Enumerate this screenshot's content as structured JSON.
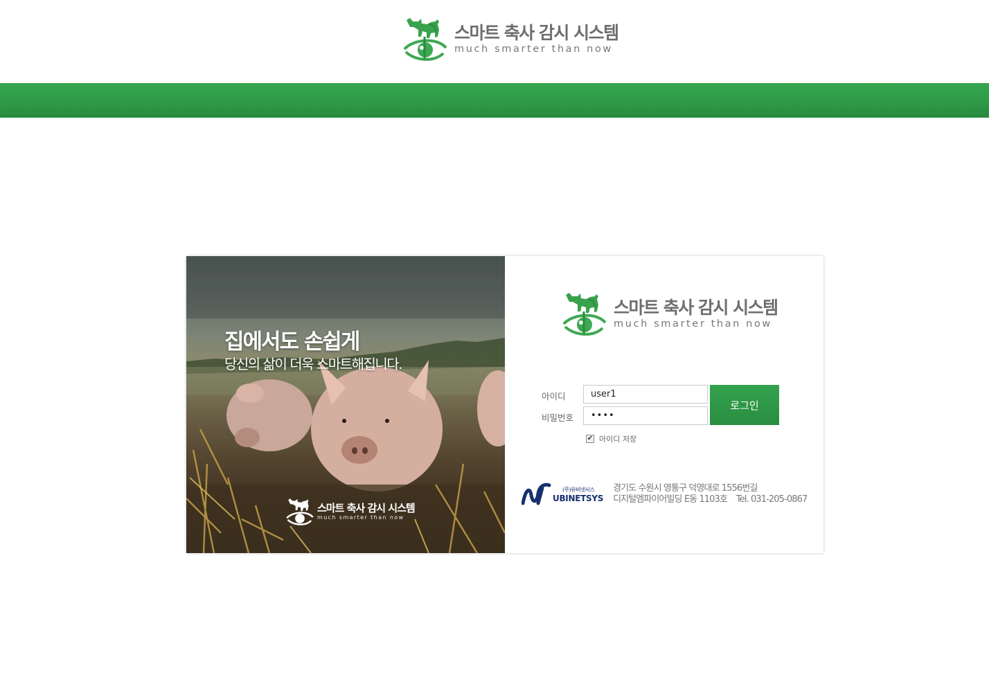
{
  "brand": {
    "title": "스마트 축사 감시 시스템",
    "tagline": "much smarter than now"
  },
  "hero": {
    "headline": "집에서도 손쉽게",
    "subline": "당신의 삶이 더욱 스마트해집니다.",
    "watermark_title": "스마트 축사 감시 시스템",
    "watermark_tagline": "much smarter than now"
  },
  "login": {
    "id_label": "아이디",
    "password_label": "비밀번호",
    "id_value": "user1",
    "password_value": "••••",
    "submit_label": "로그인",
    "save_id_label": "아이디 저장",
    "save_id_checked": true
  },
  "company": {
    "name_kor": "(주)유비넷시스",
    "name_eng": "UBINETSYS",
    "address_line1": "경기도 수원시 영통구 덕영대로 1556번길",
    "address_line2": "디지털엠파이어빌딩 E동 1103호    Tel. 031-205-0867"
  },
  "colors": {
    "brand_green": "#2f9a48",
    "text_gray": "#6e6e6e",
    "company_navy": "#16306e"
  },
  "icons": {
    "brand_logo": "cow-pig-eye-logo-icon",
    "company_logo": "ubinetsys-n-logo-icon",
    "checkbox": "checkbox-checked-icon"
  }
}
